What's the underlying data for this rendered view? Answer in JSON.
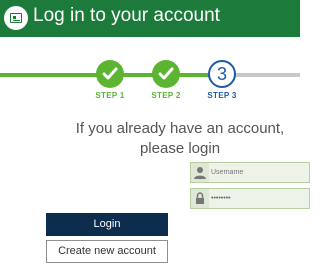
{
  "header": {
    "title": "Log in to your account",
    "icon": "id-card-icon",
    "background": "#1c7a3b"
  },
  "steps": [
    {
      "label": "STEP 1",
      "state": "done",
      "icon": "check-icon"
    },
    {
      "label": "STEP 2",
      "state": "done",
      "icon": "check-icon"
    },
    {
      "label": "STEP 3",
      "state": "current",
      "number": "3"
    }
  ],
  "colors": {
    "done": "#5cb531",
    "current": "#1e5aa8",
    "login_button": "#0d2d4f"
  },
  "intro": {
    "line1": "If you already have an account,",
    "line2": "please login"
  },
  "form": {
    "username": {
      "placeholder": "Username",
      "value": "",
      "icon": "user-icon"
    },
    "password": {
      "placeholder": "",
      "value": "••••••••",
      "icon": "lock-icon"
    }
  },
  "buttons": {
    "login": "Login",
    "create": "Create new account"
  }
}
